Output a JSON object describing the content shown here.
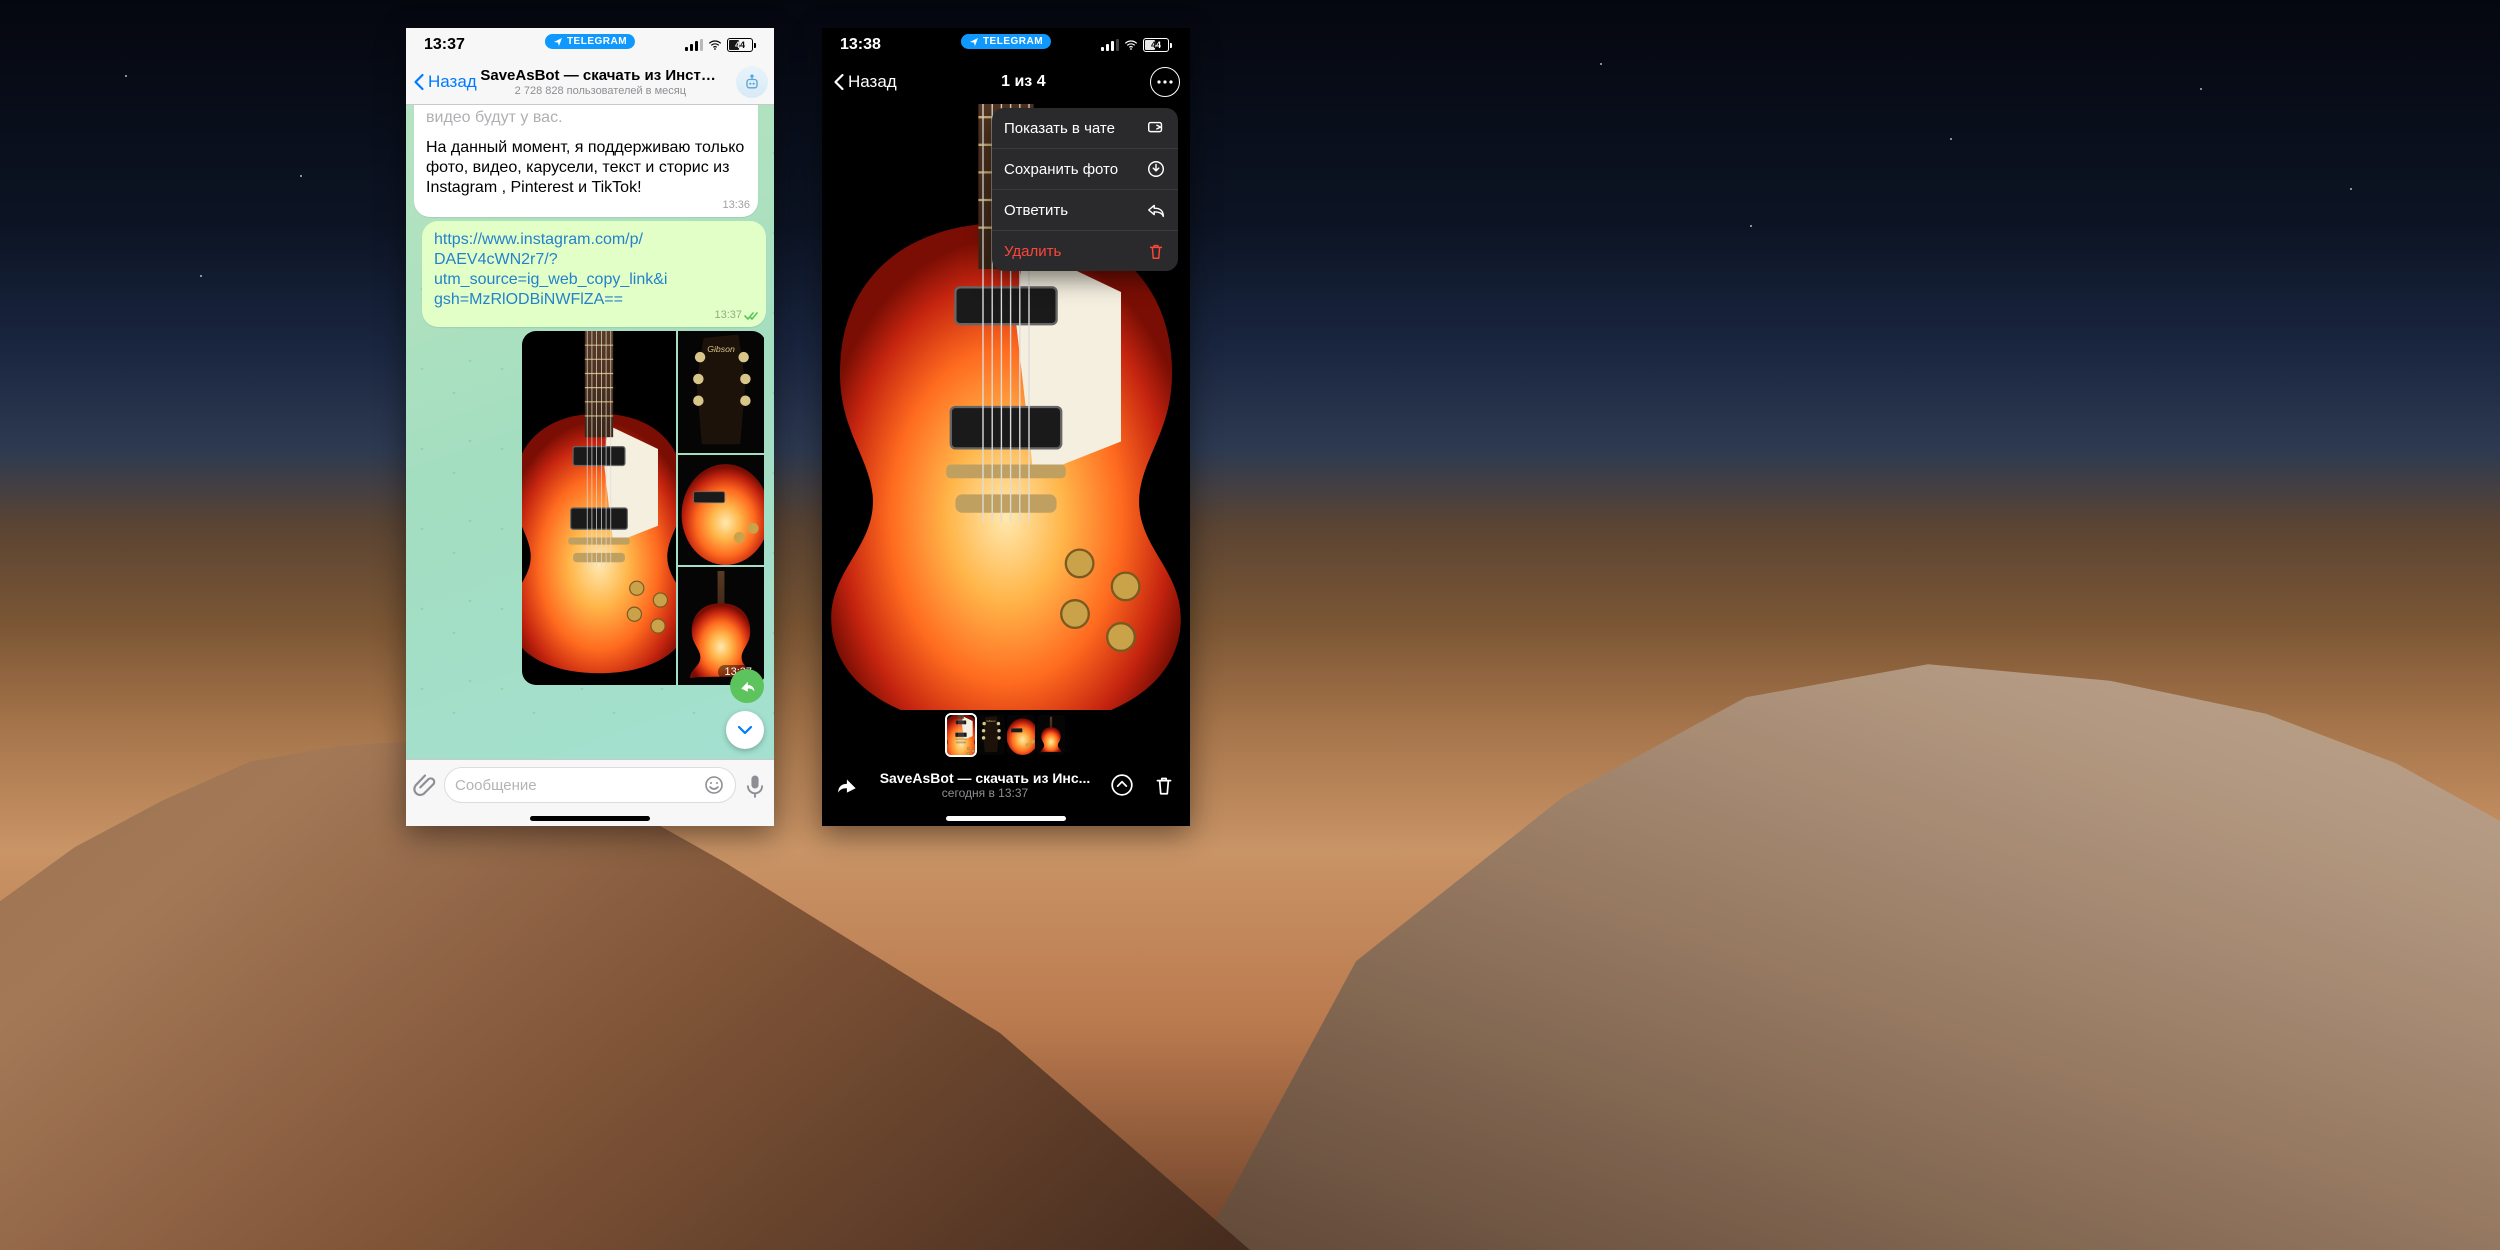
{
  "app_pill": "TELEGRAM",
  "battery_pct": "44",
  "left": {
    "time": "13:37",
    "back": "Назад",
    "chat_title": "SaveAsBot — скачать из Инста...",
    "chat_subtitle": "2 728 828 пользователей в месяц",
    "msg_in_cut": "видео будут у вас.",
    "msg_in_body": "На данный момент, я поддерживаю только фото, видео, карусели, текст и сторис из Instagram , Pinterest и TikTok!",
    "msg_in_ts": "13:36",
    "msg_out_link_l1": "https://www.instagram.com/p/",
    "msg_out_link_l2": "DAEV4cWN2r7/?",
    "msg_out_link_l3": "utm_source=ig_web_copy_link&i",
    "msg_out_link_l4": "gsh=MzRlODBiNWFlZA==",
    "msg_out_ts": "13:37",
    "media_ts": "13:37",
    "input_placeholder": "Сообщение"
  },
  "right": {
    "time": "13:38",
    "back": "Назад",
    "counter": "1 из 4",
    "menu": {
      "show_in_chat": "Показать в чате",
      "save_photo": "Сохранить фото",
      "reply": "Ответить",
      "delete": "Удалить"
    },
    "footer_title": "SaveAsBot — скачать из Инс...",
    "footer_sub": "сегодня в 13:37"
  }
}
